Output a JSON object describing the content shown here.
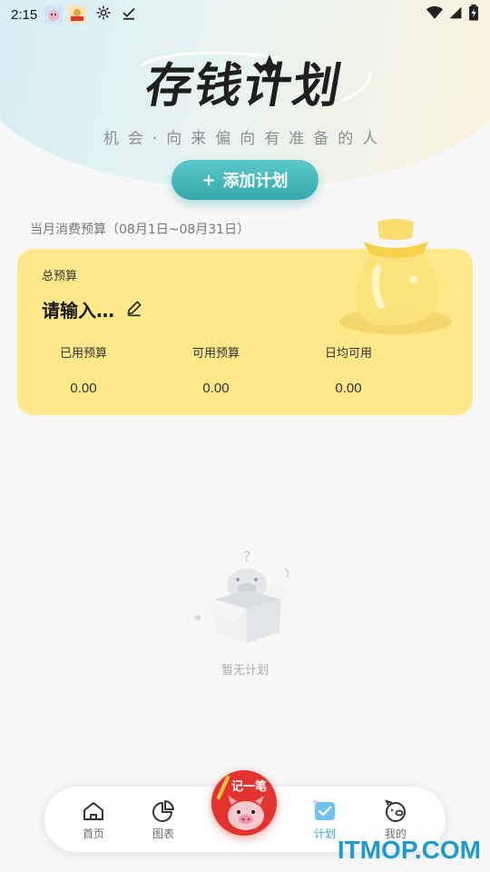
{
  "status_bar": {
    "time": "2:15",
    "icons": [
      "app-notification-icon",
      "app-notification-icon-2",
      "settings-icon",
      "download-done-icon",
      "wifi-icon",
      "signal-icon",
      "battery-icon"
    ]
  },
  "header": {
    "title": "存钱计划",
    "subtitle": "机会·向来偏向有准备的人",
    "add_button": {
      "plus": "+",
      "label": "添加计划"
    }
  },
  "budget": {
    "period": "当月消费预算（08月1日~08月31日）",
    "card_label": "总预算",
    "input_placeholder": "请输入…",
    "stats": [
      {
        "label": "已用预算",
        "value": "0.00"
      },
      {
        "label": "可用预算",
        "value": "0.00"
      },
      {
        "label": "日均可用",
        "value": "0.00"
      }
    ]
  },
  "empty_state": {
    "text": "暂无计划"
  },
  "bottom_nav": {
    "items": [
      {
        "label": "首页",
        "icon": "home-icon"
      },
      {
        "label": "图表",
        "icon": "pie-chart-icon"
      },
      {
        "label": "计划",
        "icon": "checklist-icon",
        "active": true
      },
      {
        "label": "我的",
        "icon": "pig-face-icon"
      }
    ],
    "center_fab": {
      "label": "记一笔"
    }
  },
  "watermark": "ITMOP.COM",
  "colors": {
    "accent_teal": "#3aaeb1",
    "card_yellow": "#ffe88a",
    "active_blue": "#3aa6d6",
    "fab_red": "#e3332f"
  }
}
